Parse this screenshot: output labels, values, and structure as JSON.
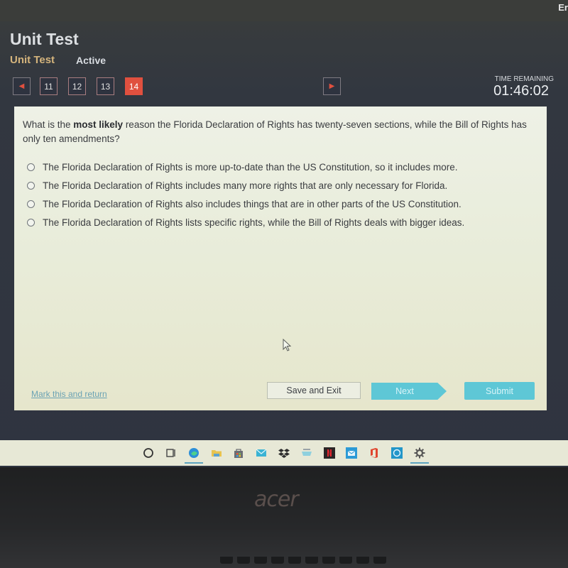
{
  "window": {
    "corner_text": "Er"
  },
  "header": {
    "title": "Unit Test",
    "subtitle": "Unit Test",
    "status": "Active"
  },
  "navigation": {
    "prev_icon": "left-arrow-icon",
    "next_icon": "right-arrow-icon",
    "question_numbers": [
      "11",
      "12",
      "13",
      "14"
    ],
    "current_question": "14"
  },
  "timer": {
    "label": "TIME REMAINING",
    "value": "01:46:02"
  },
  "question": {
    "prefix": "What is the ",
    "emphasis": "most likely",
    "suffix": " reason the Florida Declaration of Rights has twenty-seven sections, while the Bill of Rights has only ten amendments?",
    "options": [
      "The Florida Declaration of Rights is more up-to-date than the US Constitution, so it includes more.",
      "The Florida Declaration of Rights includes many more rights that are only necessary for Florida.",
      "The Florida Declaration of Rights also includes things that are in other parts of the US Constitution.",
      "The Florida Declaration of Rights lists specific rights, while the Bill of Rights deals with bigger ideas."
    ],
    "selected": null
  },
  "footer": {
    "mark_link": "Mark this and return",
    "save_exit": "Save and Exit",
    "next": "Next",
    "submit": "Submit"
  },
  "colors": {
    "accent_red": "#e0503f",
    "button_teal": "#5ec7d6",
    "subtitle_gold": "#d4b47c"
  },
  "taskbar": {
    "items": [
      {
        "name": "search",
        "icon": "search-circle-icon"
      },
      {
        "name": "task-view",
        "icon": "task-view-icon"
      },
      {
        "name": "edge",
        "icon": "edge-browser-icon",
        "running": true
      },
      {
        "name": "file-explorer",
        "icon": "folder-icon"
      },
      {
        "name": "store",
        "icon": "store-bag-icon"
      },
      {
        "name": "mail",
        "icon": "mail-icon"
      },
      {
        "name": "dropbox",
        "icon": "dropbox-icon"
      },
      {
        "name": "amazon",
        "icon": "amazon-cart-icon"
      },
      {
        "name": "netflix",
        "icon": "netflix-icon"
      },
      {
        "name": "email-app",
        "icon": "envelope-app-icon"
      },
      {
        "name": "office",
        "icon": "office-icon"
      },
      {
        "name": "whatsapp",
        "icon": "whatsapp-icon"
      },
      {
        "name": "settings",
        "icon": "gear-icon",
        "running": true
      }
    ]
  },
  "device": {
    "brand": "acer"
  }
}
